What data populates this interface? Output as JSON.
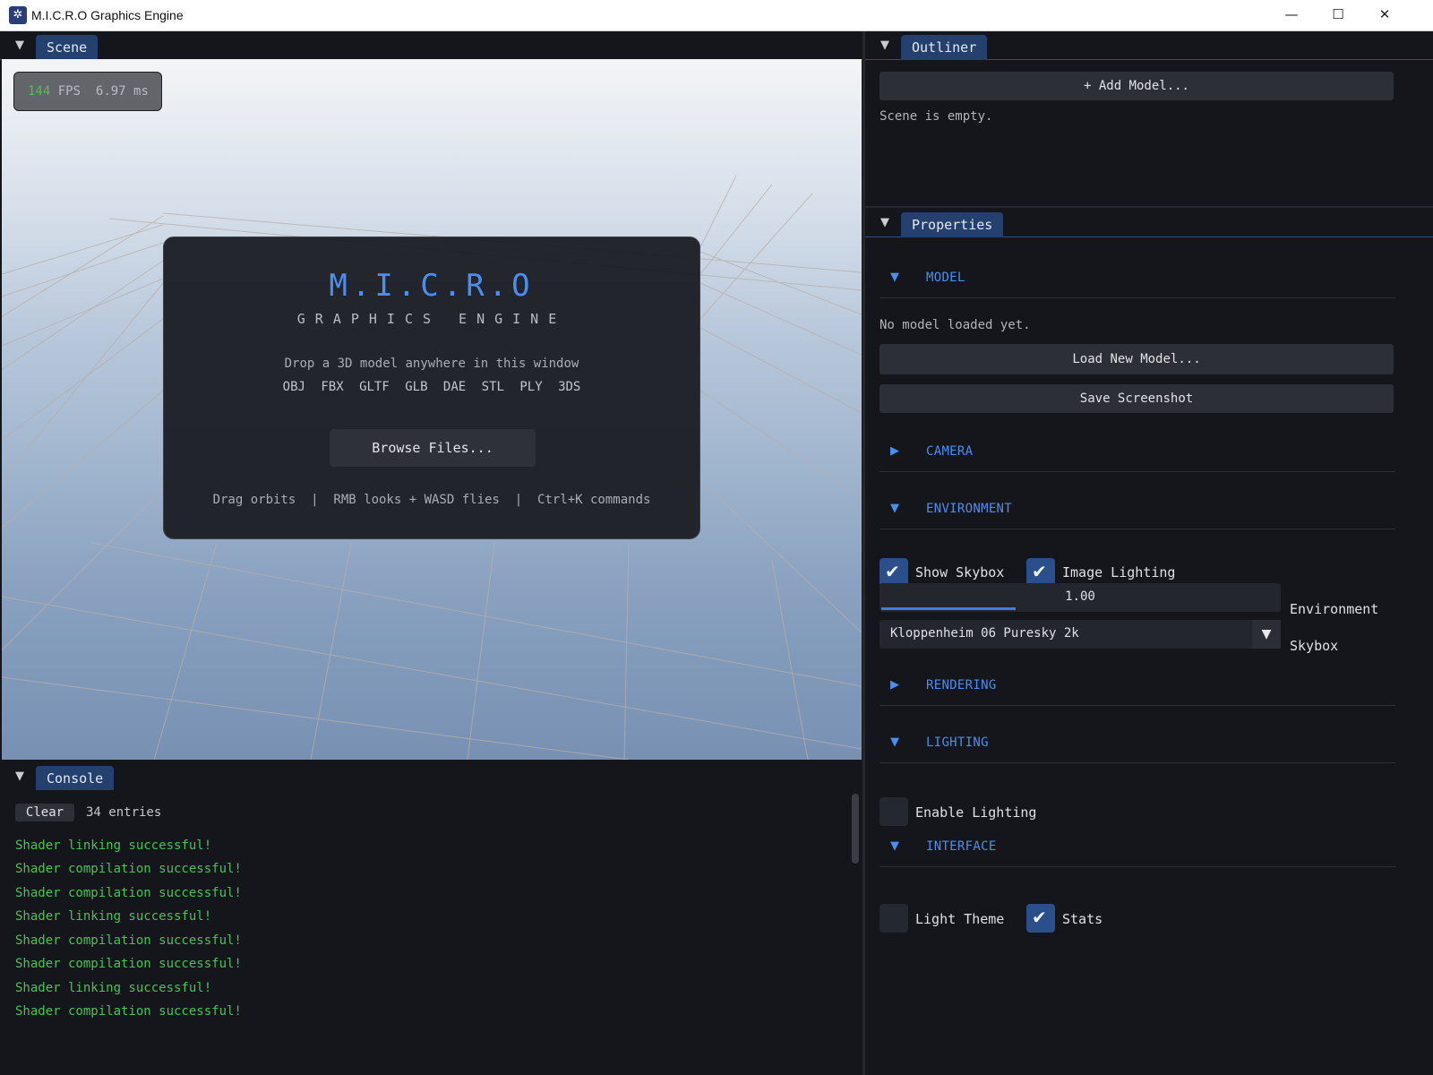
{
  "window": {
    "title": "M.I.C.R.O Graphics Engine",
    "app_icon": "micro-logo-icon",
    "controls": {
      "minimize": "—",
      "maximize": "☐",
      "close": "✕"
    }
  },
  "scene_panel": {
    "tab": "Scene",
    "stats": {
      "fps": "144",
      "fps_unit": "FPS",
      "frame_time": "6.97 ms"
    },
    "welcome": {
      "logo": "M.I.C.R.O",
      "subtitle": "GRAPHICS ENGINE",
      "drop_text": "Drop a 3D model anywhere in this window",
      "formats": "OBJ FBX GLTF GLB DAE STL PLY 3DS",
      "browse_button": "Browse Files...",
      "hints": "Drag orbits  |  RMB looks + WASD flies  |  Ctrl+K commands"
    }
  },
  "console_panel": {
    "tab": "Console",
    "clear_button": "Clear",
    "entry_count": "34 entries",
    "log": [
      "Shader linking successful!",
      "Shader compilation successful!",
      "Shader compilation successful!",
      "Shader linking successful!",
      "Shader compilation successful!",
      "Shader compilation successful!",
      "Shader linking successful!",
      "Shader compilation successful!"
    ],
    "log_color": "#49c25a"
  },
  "outliner_panel": {
    "tab": "Outliner",
    "add_model_button": "+ Add Model...",
    "empty_text": "Scene is empty."
  },
  "properties_panel": {
    "tab": "Properties",
    "sections": {
      "model": {
        "label": "MODEL",
        "expanded": true
      },
      "camera": {
        "label": "CAMERA",
        "expanded": false
      },
      "environment": {
        "label": "ENVIRONMENT",
        "expanded": true
      },
      "rendering": {
        "label": "RENDERING",
        "expanded": false
      },
      "lighting": {
        "label": "LIGHTING",
        "expanded": true
      },
      "interface": {
        "label": "INTERFACE",
        "expanded": true
      }
    },
    "model": {
      "status": "No model loaded yet.",
      "load_button": "Load New Model...",
      "screenshot_button": "Save Screenshot"
    },
    "environment": {
      "show_skybox": {
        "label": "Show Skybox",
        "checked": true
      },
      "image_lighting": {
        "label": "Image Lighting",
        "checked": true
      },
      "intensity": {
        "value": "1.00",
        "label": "Environment"
      },
      "skybox": {
        "value": "Kloppenheim 06 Puresky 2k",
        "label": "Skybox"
      }
    },
    "lighting": {
      "enable_lighting": {
        "label": "Enable Lighting",
        "checked": false
      }
    },
    "interface": {
      "light_theme": {
        "label": "Light Theme",
        "checked": false
      },
      "stats": {
        "label": "Stats",
        "checked": true
      }
    }
  },
  "colors": {
    "accent": "#4a8ef0",
    "tab_active": "#23406e",
    "panel_bg": "#14161b",
    "checkbox_on": "#2a4f8a"
  }
}
